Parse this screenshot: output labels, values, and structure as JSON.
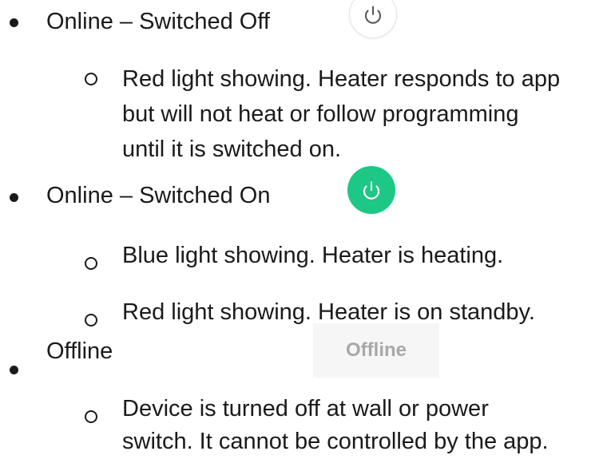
{
  "colors": {
    "text": "#1a1a1a",
    "power_on_green": "#1dc785",
    "power_off_bg": "#ffffff",
    "power_off_icon": "#555555",
    "offline_chip_bg": "#f6f6f6",
    "offline_chip_text": "#a8a8a8"
  },
  "items": [
    {
      "label": "Online – Switched Off",
      "icon": "power-icon",
      "sub_items": [
        {
          "lines": [
            "Red light showing. Heater responds to app",
            "but will not heat or follow programming",
            "until it is switched on."
          ]
        }
      ]
    },
    {
      "label": "Online – Switched On",
      "icon": "power-icon",
      "sub_items": [
        {
          "lines": [
            "Blue light showing. Heater is heating."
          ]
        },
        {
          "lines": [
            "Red light showing. Heater is on standby."
          ]
        }
      ]
    },
    {
      "label": "Offline",
      "chip_label": "Offline",
      "sub_items": [
        {
          "lines": [
            "Device is turned off at wall or power",
            "switch. It cannot be controlled by the app."
          ]
        }
      ]
    }
  ]
}
